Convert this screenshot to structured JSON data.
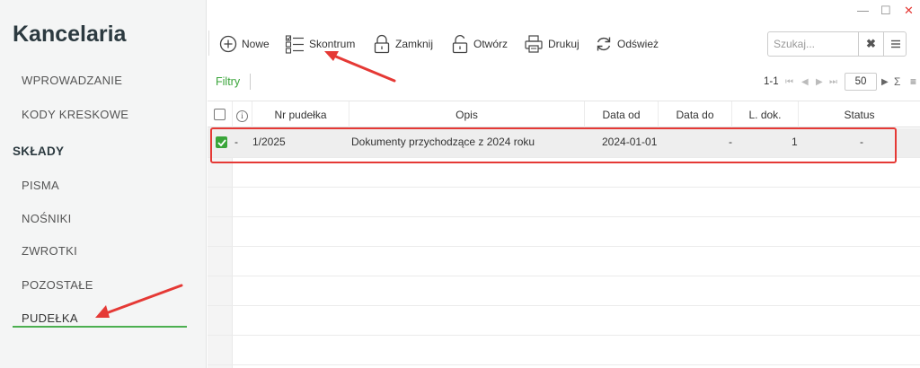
{
  "app": {
    "title": "Kancelaria"
  },
  "window": {
    "minimize": "—",
    "maximize": "☐",
    "close": "✕"
  },
  "sidebar": {
    "items": [
      {
        "label": "WPROWADZANIE"
      },
      {
        "label": "KODY KRESKOWE"
      }
    ],
    "section": "SKŁADY",
    "sub_items": [
      {
        "label": "PISMA"
      },
      {
        "label": "NOŚNIKI"
      },
      {
        "label": "ZWROTKI"
      },
      {
        "label": "POZOSTAŁE"
      },
      {
        "label": "PUDEŁKA",
        "active": true
      }
    ]
  },
  "toolbar": {
    "buttons": [
      {
        "label": "Nowe",
        "icon": "plus-circle-icon"
      },
      {
        "label": "Skontrum",
        "icon": "checklist-icon"
      },
      {
        "label": "Zamknij",
        "icon": "lock-icon"
      },
      {
        "label": "Otwórz",
        "icon": "unlock-icon"
      },
      {
        "label": "Drukuj",
        "icon": "printer-icon"
      },
      {
        "label": "Odśwież",
        "icon": "refresh-icon"
      }
    ],
    "search": {
      "placeholder": "Szukaj...",
      "value": ""
    }
  },
  "filter": {
    "label": "Filtry"
  },
  "pager": {
    "range": "1-1",
    "page_size": "50"
  },
  "table": {
    "columns": [
      "Nr pudełka",
      "Opis",
      "Data od",
      "Data do",
      "L. dok.",
      "Status"
    ],
    "rows": [
      {
        "checked": true,
        "marker": "-",
        "nr": "1/2025",
        "opis": "Dokumenty przychodzące z 2024 roku",
        "data_od": "2024-01-01",
        "data_do": "-",
        "l_dok": "1",
        "status": "-"
      }
    ]
  },
  "colors": {
    "accent": "#3aa53a",
    "annotation": "#e53935"
  }
}
